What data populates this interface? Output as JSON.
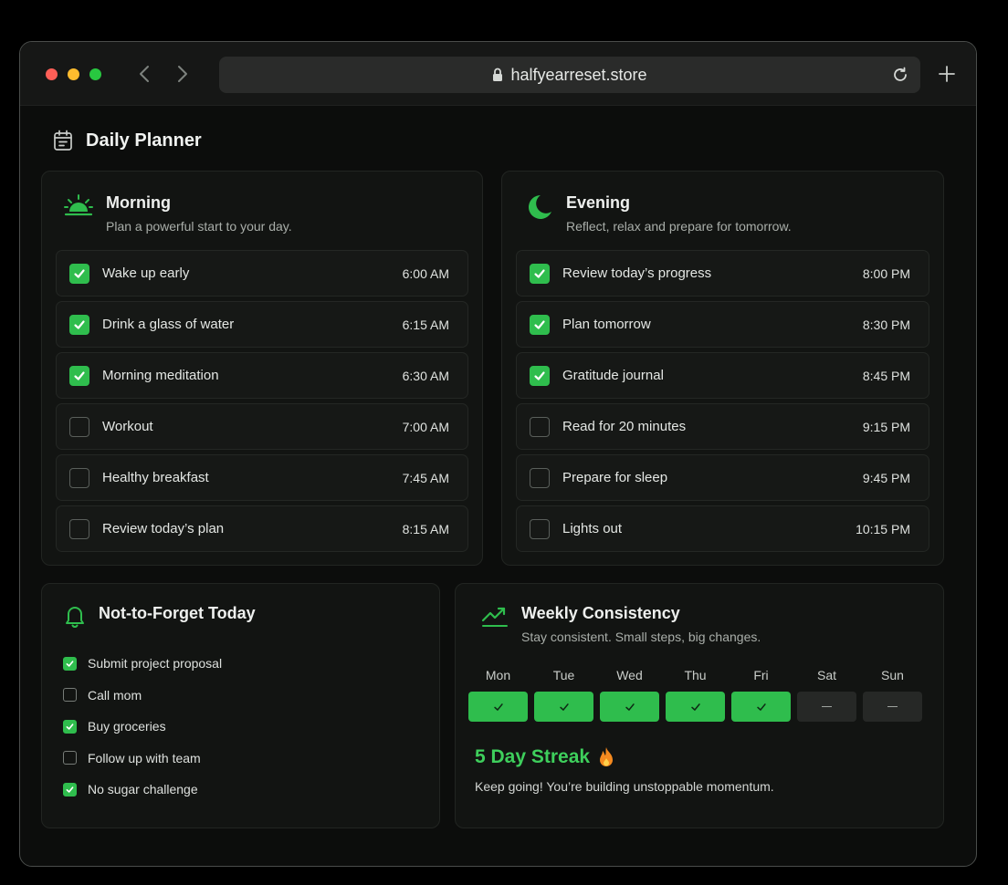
{
  "browser": {
    "url": "halfyearreset.store"
  },
  "page": {
    "title": "Daily Planner"
  },
  "morning": {
    "title": "Morning",
    "subtitle": "Plan a powerful start to your day.",
    "tasks": [
      {
        "label": "Wake up early",
        "time": "6:00 AM",
        "done": true
      },
      {
        "label": "Drink a glass of water",
        "time": "6:15 AM",
        "done": true
      },
      {
        "label": "Morning meditation",
        "time": "6:30 AM",
        "done": true
      },
      {
        "label": "Workout",
        "time": "7:00 AM",
        "done": false
      },
      {
        "label": "Healthy breakfast",
        "time": "7:45 AM",
        "done": false
      },
      {
        "label": "Review today’s plan",
        "time": "8:15 AM",
        "done": false
      }
    ]
  },
  "evening": {
    "title": "Evening",
    "subtitle": "Reflect, relax and prepare for tomorrow.",
    "tasks": [
      {
        "label": "Review today’s progress",
        "time": "8:00 PM",
        "done": true
      },
      {
        "label": "Plan tomorrow",
        "time": "8:30 PM",
        "done": true
      },
      {
        "label": "Gratitude journal",
        "time": "8:45 PM",
        "done": true
      },
      {
        "label": "Read for 20 minutes",
        "time": "9:15 PM",
        "done": false
      },
      {
        "label": "Prepare for sleep",
        "time": "9:45 PM",
        "done": false
      },
      {
        "label": "Lights out",
        "time": "10:15 PM",
        "done": false
      }
    ]
  },
  "not_to_forget": {
    "title": "Not-to-Forget Today",
    "items": [
      {
        "label": "Submit project proposal",
        "done": true
      },
      {
        "label": "Call mom",
        "done": false
      },
      {
        "label": "Buy groceries",
        "done": true
      },
      {
        "label": "Follow up with team",
        "done": false
      },
      {
        "label": "No sugar challenge",
        "done": true
      }
    ]
  },
  "weekly": {
    "title": "Weekly Consistency",
    "subtitle": "Stay consistent. Small steps, big changes.",
    "days": [
      {
        "label": "Mon",
        "done": true
      },
      {
        "label": "Tue",
        "done": true
      },
      {
        "label": "Wed",
        "done": true
      },
      {
        "label": "Thu",
        "done": true
      },
      {
        "label": "Fri",
        "done": true
      },
      {
        "label": "Sat",
        "done": false
      },
      {
        "label": "Sun",
        "done": false
      }
    ],
    "streak": "5 Day Streak",
    "streak_icon": "fire-icon",
    "message": "Keep going! You’re building unstoppable momentum."
  },
  "colors": {
    "accent": "#2fbd4d",
    "accent_text": "#3ecf5c",
    "background": "#0c0d0c",
    "card": "#121412"
  }
}
